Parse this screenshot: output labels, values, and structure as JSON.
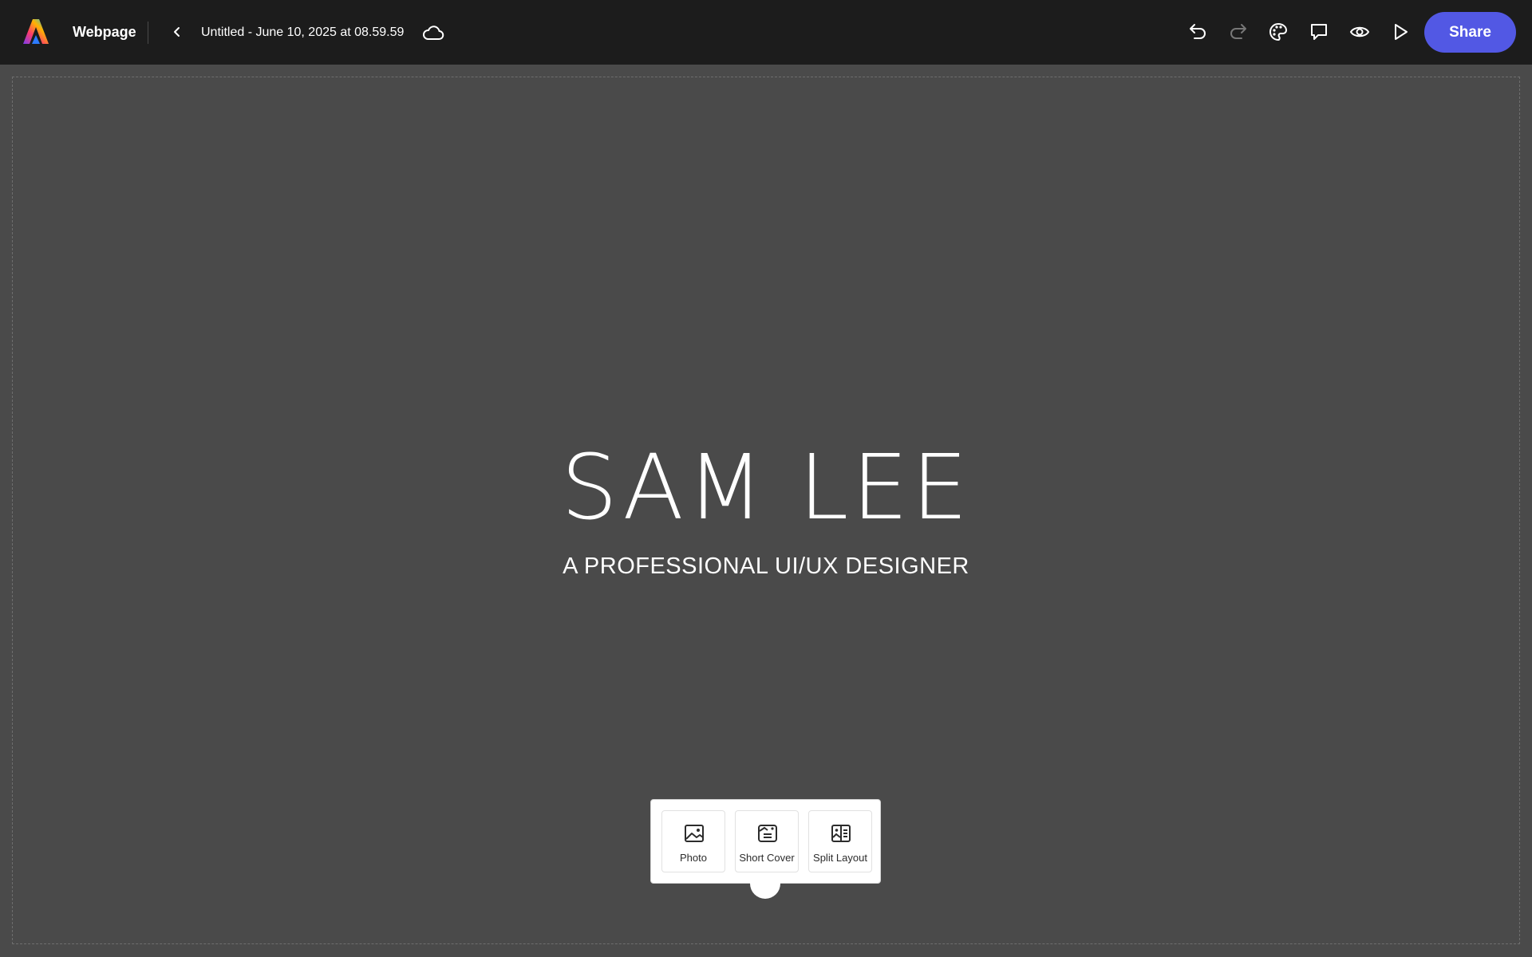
{
  "header": {
    "app_name": "Webpage",
    "doc_title": "Untitled - June 10, 2025 at 08.59.59",
    "share_label": "Share",
    "icons": [
      "adobe-express-logo",
      "back-chevron-icon",
      "cloud-icon",
      "undo-icon",
      "redo-icon",
      "theme-palette-icon",
      "comment-icon",
      "preview-eye-icon",
      "play-icon"
    ]
  },
  "content": {
    "title": "SAM LEE",
    "subtitle": "A PROFESSIONAL UI/UX DESIGNER"
  },
  "block_picker": {
    "items": [
      {
        "label": "Photo",
        "icon": "photo-icon"
      },
      {
        "label": "Short Cover",
        "icon": "short-cover-icon"
      },
      {
        "label": "Split Layout",
        "icon": "split-layout-icon"
      }
    ]
  },
  "colors": {
    "topbar": "#1c1c1c",
    "canvas": "#4a4a4a",
    "share_button": "#5258e4",
    "text": "#ffffff"
  }
}
